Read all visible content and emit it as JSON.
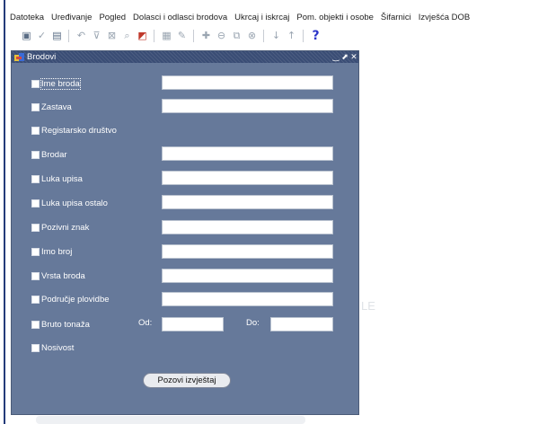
{
  "menubar": {
    "items": [
      "Datoteka",
      "Uređivanje",
      "Pogled",
      "Dolasci i odlasci brodova",
      "Ukrcaj i iskrcaj",
      "Pom. objekti i osobe",
      "Šifarnici",
      "Izvješća DOB"
    ]
  },
  "toolbar": {
    "icons": [
      "save-icon",
      "check-icon",
      "print-icon",
      "undo-icon",
      "filter-icon",
      "clear-filter-icon",
      "query-icon",
      "exit-icon",
      "list-icon",
      "edit-icon",
      "insert-record-icon",
      "delete-record-icon",
      "duplicate-icon",
      "clear-record-icon",
      "next-icon",
      "previous-icon",
      "help-icon"
    ],
    "help_symbol": "?"
  },
  "window": {
    "title": "Brodovi",
    "buttons": {
      "minimize": "‿",
      "restore": "⬈",
      "close": "✕"
    }
  },
  "form": {
    "fields": [
      {
        "label": "Ime broda",
        "value": "",
        "has_input": true,
        "checked": false
      },
      {
        "label": "Zastava",
        "value": "",
        "has_input": true,
        "checked": false
      },
      {
        "label": "Registarsko društvo",
        "has_input": false,
        "checked": false
      },
      {
        "label": "Brodar",
        "value": "",
        "has_input": true,
        "checked": false
      },
      {
        "label": "Luka upisa",
        "value": "",
        "has_input": true,
        "checked": false
      },
      {
        "label": "Luka upisa ostalo",
        "value": "",
        "has_input": true,
        "checked": false
      },
      {
        "label": "Pozivni znak",
        "value": "",
        "has_input": true,
        "checked": false
      },
      {
        "label": "Imo broj",
        "value": "",
        "has_input": true,
        "checked": false
      },
      {
        "label": "Vrsta broda",
        "value": "",
        "has_input": true,
        "checked": false
      },
      {
        "label": "Područje plovidbe",
        "value": "",
        "has_input": true,
        "checked": false
      },
      {
        "label": "Bruto tonaža",
        "from_label": "Od:",
        "to_label": "Do:",
        "from_value": "",
        "to_value": "",
        "checked": false
      },
      {
        "label": "Nosivost",
        "has_input": false,
        "checked": false
      }
    ],
    "submit_label": "Pozovi izvještaj"
  },
  "watermark": {
    "text": "LE"
  }
}
